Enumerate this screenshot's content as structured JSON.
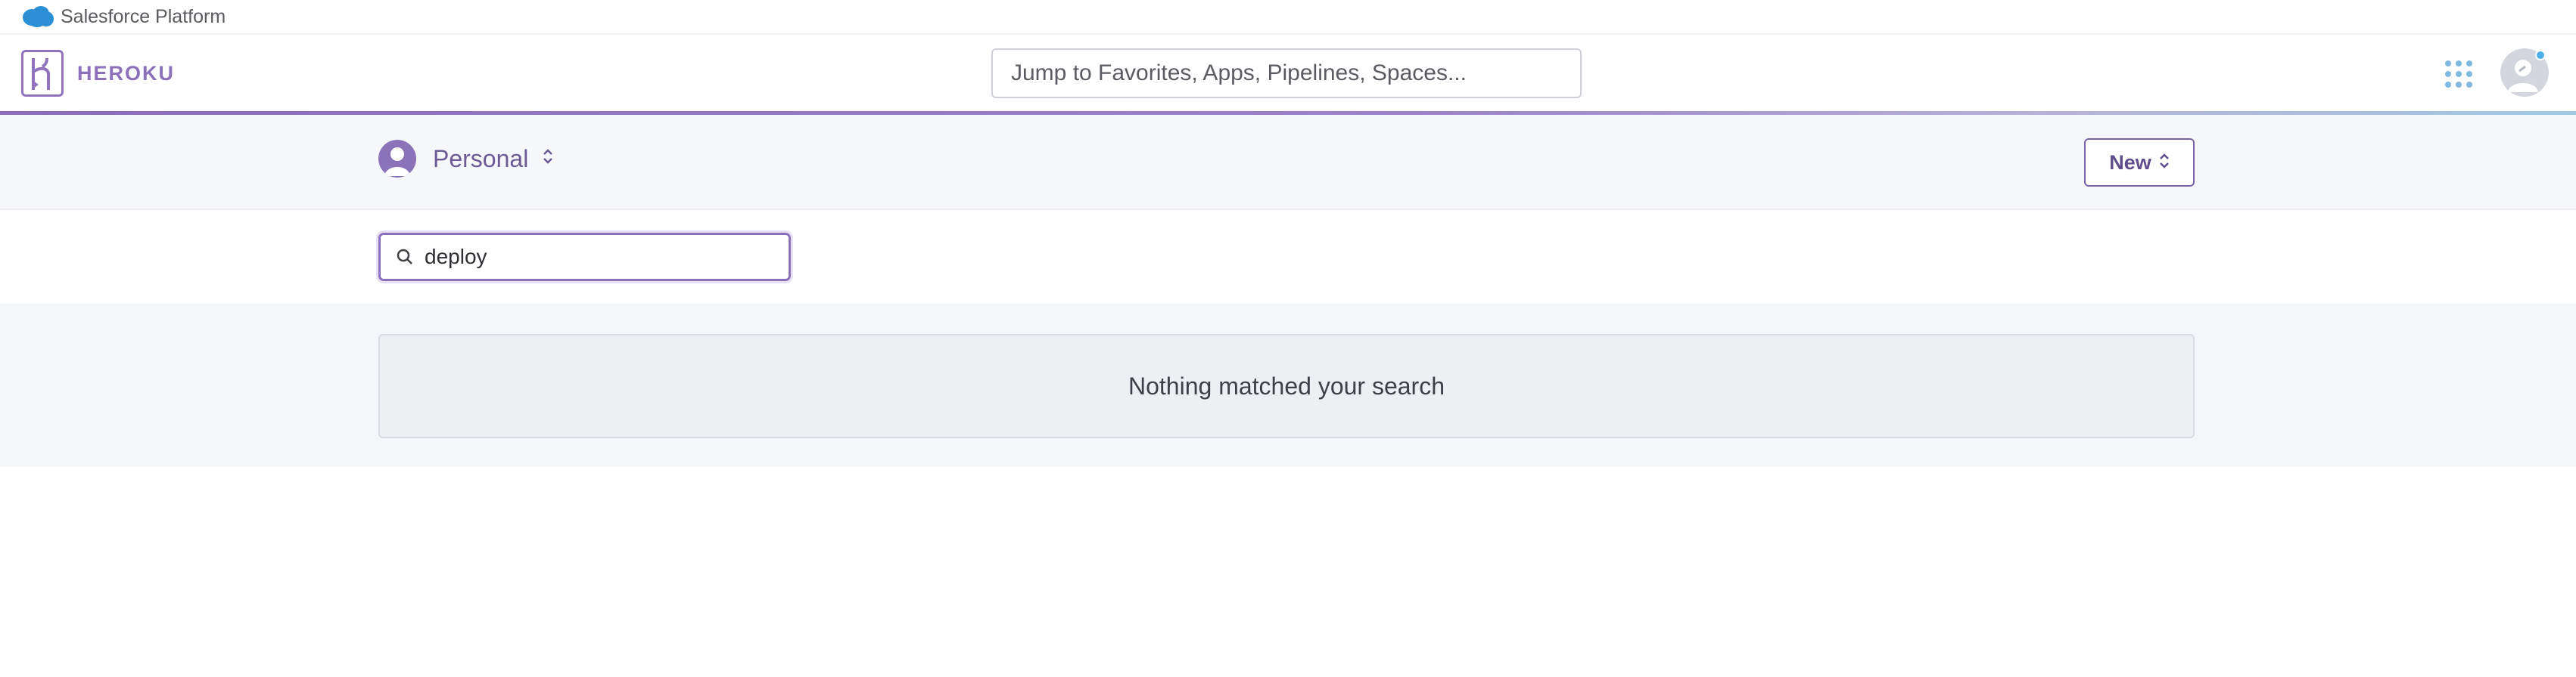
{
  "salesforce_bar": {
    "label": "Salesforce Platform",
    "cloud_icon": "salesforce-cloud-icon",
    "cloud_color": "#2b8fd6"
  },
  "header": {
    "logo_text": "HEROKU",
    "logo_icon": "heroku-logo-icon",
    "brand_color": "#8b70ba",
    "jump_placeholder": "Jump to Favorites, Apps, Pipelines, Spaces...",
    "apps_icon": "apps-grid-icon",
    "avatar_icon": "user-avatar-icon",
    "notification_color": "#4fb0e8"
  },
  "subheader": {
    "account_name": "Personal",
    "account_caret": "⌃⌄",
    "new_label": "New",
    "new_caret": "⌃⌄"
  },
  "filter": {
    "value": "deploy",
    "icon": "search-icon"
  },
  "results": {
    "empty_message": "Nothing matched your search"
  }
}
